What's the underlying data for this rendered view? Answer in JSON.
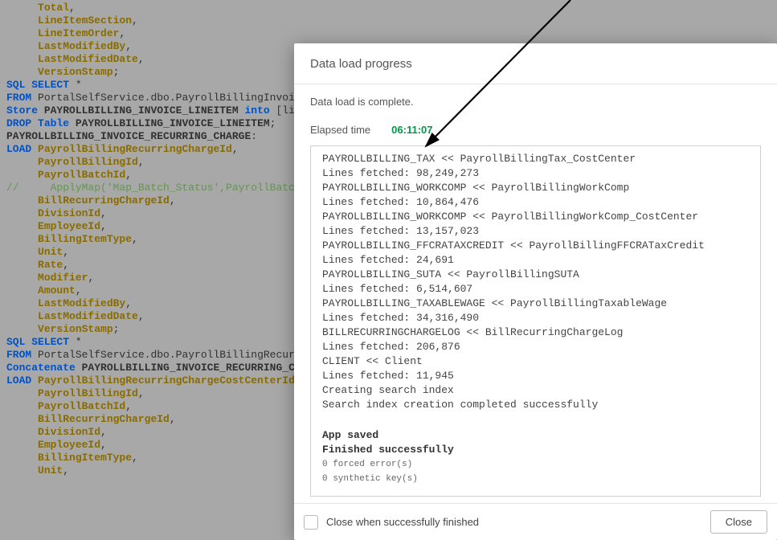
{
  "code": [
    [
      [
        "fld",
        "Total"
      ],
      [
        "punc",
        ","
      ]
    ],
    [
      [
        "fld",
        "LineItemSection"
      ],
      [
        "punc",
        ","
      ]
    ],
    [
      [
        "fld",
        "LineItemOrder"
      ],
      [
        "punc",
        ","
      ]
    ],
    [
      [
        "fld",
        "LastModifiedBy"
      ],
      [
        "punc",
        ","
      ]
    ],
    [
      [
        "fld",
        "LastModifiedDate"
      ],
      [
        "punc",
        ","
      ]
    ],
    [
      [
        "fld",
        "VersionStamp"
      ],
      [
        "punc",
        ";"
      ]
    ],
    [
      [
        "kw",
        "SQL SELECT "
      ],
      [
        "star",
        "*"
      ]
    ],
    [
      [
        "kw",
        "FROM"
      ],
      [
        "punc",
        " PortalSelfService.dbo.PayrollBillingInvoi"
      ]
    ],
    [
      [
        "kw",
        "Store"
      ],
      [
        "tbl",
        " PAYROLLBILLING_INVOICE_LINEITEM "
      ],
      [
        "kw",
        "into "
      ],
      [
        "punc",
        "[li"
      ]
    ],
    [
      [
        "kw",
        "DROP "
      ],
      [
        "kw",
        "Table "
      ],
      [
        "tbl",
        "PAYROLLBILLING_INVOICE_LINEITEM"
      ],
      [
        "punc",
        ";"
      ]
    ],
    [
      [
        "",
        ""
      ]
    ],
    [
      [
        "",
        ""
      ]
    ],
    [
      [
        "tbl",
        "PAYROLLBILLING_INVOICE_RECURRING_CHARGE"
      ],
      [
        "punc",
        ":"
      ]
    ],
    [
      [
        "kw",
        "LOAD "
      ],
      [
        "fld",
        "PayrollBillingRecurringChargeId"
      ],
      [
        "punc",
        ","
      ]
    ],
    [
      [
        "fld",
        "PayrollBillingId"
      ],
      [
        "punc",
        ","
      ]
    ],
    [
      [
        "fld",
        "PayrollBatchId"
      ],
      [
        "punc",
        ","
      ]
    ],
    [
      [
        "cmt",
        "//     ApplyMap('Map_Batch_Status',PayrollBatch"
      ]
    ],
    [
      [
        "fld",
        "BillRecurringChargeId"
      ],
      [
        "punc",
        ","
      ]
    ],
    [
      [
        "fld",
        "DivisionId"
      ],
      [
        "punc",
        ","
      ]
    ],
    [
      [
        "fld",
        "EmployeeId"
      ],
      [
        "punc",
        ","
      ]
    ],
    [
      [
        "fld",
        "BillingItemType"
      ],
      [
        "punc",
        ","
      ]
    ],
    [
      [
        "fld",
        "Unit"
      ],
      [
        "punc",
        ","
      ]
    ],
    [
      [
        "fld",
        "Rate"
      ],
      [
        "punc",
        ","
      ]
    ],
    [
      [
        "fld",
        "Modifier"
      ],
      [
        "punc",
        ","
      ]
    ],
    [
      [
        "fld",
        "Amount"
      ],
      [
        "punc",
        ","
      ]
    ],
    [
      [
        "fld",
        "LastModifiedBy"
      ],
      [
        "punc",
        ","
      ]
    ],
    [
      [
        "fld",
        "LastModifiedDate"
      ],
      [
        "punc",
        ","
      ]
    ],
    [
      [
        "fld",
        "VersionStamp"
      ],
      [
        "punc",
        ";"
      ]
    ],
    [
      [
        "kw",
        "SQL SELECT "
      ],
      [
        "star",
        "*"
      ]
    ],
    [
      [
        "kw",
        "FROM"
      ],
      [
        "punc",
        " PortalSelfService.dbo.PayrollBillingRecur"
      ]
    ],
    [
      [
        "",
        ""
      ]
    ],
    [
      [
        "kw",
        "Concatenate "
      ],
      [
        "tbl",
        "PAYROLLBILLING_INVOICE_RECURRING_C"
      ]
    ],
    [
      [
        "kw",
        "LOAD "
      ],
      [
        "fld",
        "PayrollBillingRecurringChargeCostCenterId"
      ]
    ],
    [
      [
        "fld",
        "PayrollBillingId"
      ],
      [
        "punc",
        ","
      ]
    ],
    [
      [
        "fld",
        "PayrollBatchId"
      ],
      [
        "punc",
        ","
      ]
    ],
    [
      [
        "fld",
        "BillRecurringChargeId"
      ],
      [
        "punc",
        ","
      ]
    ],
    [
      [
        "fld",
        "DivisionId"
      ],
      [
        "punc",
        ","
      ]
    ],
    [
      [
        "fld",
        "EmployeeId"
      ],
      [
        "punc",
        ","
      ]
    ],
    [
      [
        "fld",
        "BillingItemType"
      ],
      [
        "punc",
        ","
      ]
    ],
    [
      [
        "fld",
        "Unit"
      ],
      [
        "punc",
        ","
      ]
    ]
  ],
  "code_indent_lines": {
    "0": 1,
    "1": 1,
    "2": 1,
    "3": 1,
    "4": 1,
    "5": 1,
    "14": 1,
    "15": 1,
    "17": 1,
    "18": 1,
    "19": 1,
    "20": 1,
    "21": 1,
    "22": 1,
    "23": 1,
    "24": 1,
    "25": 1,
    "26": 1,
    "27": 1,
    "33": 1,
    "34": 1,
    "35": 1,
    "36": 1,
    "37": 1,
    "38": 1,
    "39": 1
  },
  "modal": {
    "title": "Data load progress",
    "status": "Data load is complete.",
    "elapsed_label": "Elapsed time",
    "elapsed_value": "06:11:07",
    "close_checkbox_label": "Close when successfully finished",
    "close_button": "Close"
  },
  "log": [
    {
      "cls": "log-line",
      "text": "PAYROLLBILLING_TAX << PayrollBillingTax_CostCenter"
    },
    {
      "cls": "log-line",
      "text": "Lines fetched: 98,249,273"
    },
    {
      "cls": "log-line",
      "text": "PAYROLLBILLING_WORKCOMP << PayrollBillingWorkComp"
    },
    {
      "cls": "log-line",
      "text": "Lines fetched: 10,864,476"
    },
    {
      "cls": "log-line",
      "text": "PAYROLLBILLING_WORKCOMP << PayrollBillingWorkComp_CostCenter"
    },
    {
      "cls": "log-line",
      "text": "Lines fetched: 13,157,023"
    },
    {
      "cls": "log-line",
      "text": "PAYROLLBILLING_FFCRATAXCREDIT << PayrollBillingFFCRATaxCredit"
    },
    {
      "cls": "log-line",
      "text": "Lines fetched: 24,691"
    },
    {
      "cls": "log-line",
      "text": "PAYROLLBILLING_SUTA << PayrollBillingSUTA"
    },
    {
      "cls": "log-line",
      "text": "Lines fetched: 6,514,607"
    },
    {
      "cls": "log-line",
      "text": "PAYROLLBILLING_TAXABLEWAGE << PayrollBillingTaxableWage"
    },
    {
      "cls": "log-line",
      "text": "Lines fetched: 34,316,490"
    },
    {
      "cls": "log-line",
      "text": "BILLRECURRINGCHARGELOG << BillRecurringChargeLog"
    },
    {
      "cls": "log-line",
      "text": "Lines fetched: 206,876"
    },
    {
      "cls": "log-line",
      "text": "CLIENT << Client"
    },
    {
      "cls": "log-line",
      "text": "Lines fetched: 11,945"
    },
    {
      "cls": "log-line",
      "text": "Creating search index"
    },
    {
      "cls": "log-line",
      "text": "Search index creation completed successfully"
    },
    {
      "cls": "log-gap",
      "text": ""
    },
    {
      "cls": "log-bold",
      "text": "App saved"
    },
    {
      "cls": "log-bold",
      "text": "Finished successfully"
    },
    {
      "cls": "log-small",
      "text": "0 forced error(s)"
    },
    {
      "cls": "log-small",
      "text": "0 synthetic key(s)"
    }
  ]
}
